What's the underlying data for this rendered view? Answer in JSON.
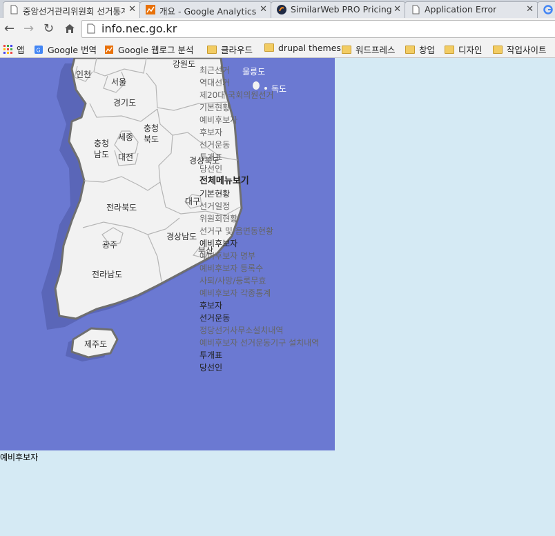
{
  "tabs": [
    {
      "title": "중앙선거관리위원회 선거통계",
      "active": true
    },
    {
      "title": "개요 - Google Analytics",
      "active": false
    },
    {
      "title": "SimilarWeb PRO Pricing",
      "active": false
    },
    {
      "title": "Application Error",
      "active": false
    }
  ],
  "toolbar": {
    "url": "info.nec.go.kr"
  },
  "bookmarks": {
    "apps": "앱",
    "items": [
      "Google 번역",
      "Google 웹로그 분석",
      "클라우드",
      "drupal themes",
      "워드프레스",
      "창업",
      "디자인",
      "작업사이트"
    ]
  },
  "map": {
    "regions": [
      "인천",
      "서울",
      "강원도",
      "경기도",
      "충청\n북도",
      "충청\n남도",
      "세종",
      "대전",
      "경상북도",
      "대구",
      "전라북도",
      "광주",
      "경상남도",
      "부산",
      "전라남도",
      "제주도",
      "울릉도",
      "독도"
    ]
  },
  "menu": {
    "items": [
      {
        "text": "최근선거",
        "style": "gray"
      },
      {
        "text": "역대선거",
        "style": "gray"
      },
      {
        "text": "제20대 국회의원선거",
        "style": "gray"
      },
      {
        "text": "기본현황",
        "style": "gray"
      },
      {
        "text": "예비후보자",
        "style": "gray"
      },
      {
        "text": "후보자",
        "style": "gray"
      },
      {
        "text": "선거운동",
        "style": "gray"
      },
      {
        "text": "투개표",
        "style": "gray"
      },
      {
        "text": "당선인",
        "style": "gray"
      },
      {
        "text": "전체메뉴보기",
        "style": "heading"
      },
      {
        "text": "기본현황",
        "style": "dark"
      },
      {
        "text": "선거일정",
        "style": "gray"
      },
      {
        "text": "위원회현황",
        "style": "gray"
      },
      {
        "text": "선거구 및 읍면동현황",
        "style": "gray"
      },
      {
        "text": "예비후보자",
        "style": "dark"
      },
      {
        "text": "예비후보자 명부",
        "style": "gray"
      },
      {
        "text": "예비후보자 등록수",
        "style": "gray"
      },
      {
        "text": "사퇴/사망/등록무효",
        "style": "gray"
      },
      {
        "text": "예비후보자 각종통계",
        "style": "gray"
      },
      {
        "text": "후보자",
        "style": "dark"
      },
      {
        "text": "선거운동",
        "style": "dark"
      },
      {
        "text": "정당선거사무소설치내역",
        "style": "gray"
      },
      {
        "text": "예비후보자 선거운동기구 설치내역",
        "style": "gray"
      },
      {
        "text": "투개표",
        "style": "dark"
      },
      {
        "text": "당선인",
        "style": "dark"
      }
    ]
  },
  "bottom_text": "예비후보자",
  "colors": {
    "map_bg": "#6b79d2",
    "land": "#f2f2f2",
    "page_bg": "#d5eaf4",
    "gray_text": "#666666",
    "dark_text": "#222222"
  }
}
